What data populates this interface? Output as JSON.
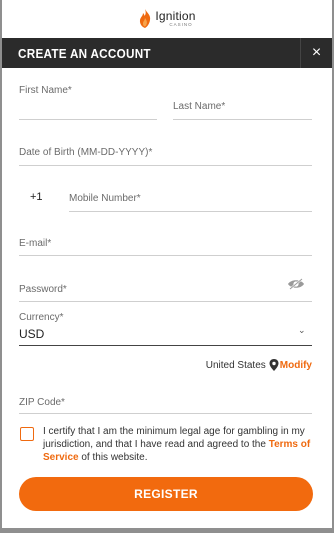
{
  "brand": {
    "name": "Ignition",
    "sub": "CASINO",
    "color": "#ef6a10"
  },
  "header": {
    "title": "CREATE AN ACCOUNT",
    "close": "×"
  },
  "form": {
    "first_name": "First Name*",
    "last_name": "Last Name*",
    "dob": "Date of Birth (MM-DD-YYYY)*",
    "country_code": "+1",
    "mobile": "Mobile Number*",
    "email": "E-mail*",
    "password": "Password*",
    "currency_label": "Currency*",
    "currency_value": "USD",
    "location": "United States",
    "modify": "Modify",
    "zip": "ZIP Code*",
    "terms_pre": "I certify that I am the minimum legal age for gambling in my jurisdiction, and that I have read and agreed to the ",
    "terms_link": "Terms of Service",
    "terms_post": " of this website.",
    "register": "REGISTER"
  },
  "colors": {
    "accent": "#f26a0e",
    "header_bg": "#2b2b2b"
  }
}
